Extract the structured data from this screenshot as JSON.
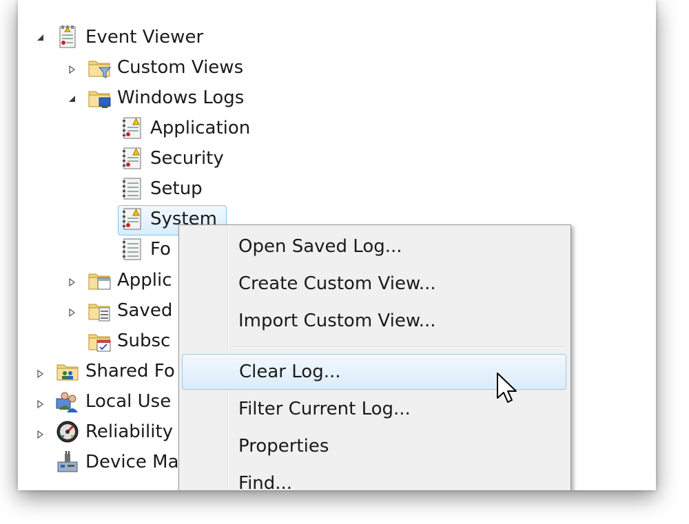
{
  "tree": {
    "items": [
      {
        "label": "Event Viewer",
        "icon": "event-viewer-icon",
        "expanded": true
      },
      {
        "label": "Custom Views",
        "icon": "folder-filter-icon",
        "expanded": false
      },
      {
        "label": "Windows Logs",
        "icon": "folder-computer-icon",
        "expanded": true
      },
      {
        "label": "Application",
        "icon": "log-warning-icon"
      },
      {
        "label": "Security",
        "icon": "log-warning-icon"
      },
      {
        "label": "Setup",
        "icon": "log-icon"
      },
      {
        "label": "System",
        "icon": "log-warning-icon",
        "selected": true
      },
      {
        "label": "Fo",
        "icon": "log-icon"
      },
      {
        "label": "Applic",
        "icon": "folder-window-icon",
        "expanded": false
      },
      {
        "label": "Saved",
        "icon": "folder-list-icon",
        "expanded": false
      },
      {
        "label": "Subsc",
        "icon": "folder-calendar-icon"
      },
      {
        "label": "Shared Fo",
        "icon": "shared-folders-icon",
        "expanded": false
      },
      {
        "label": "Local Use",
        "icon": "users-icon",
        "expanded": false
      },
      {
        "label": "Reliability",
        "icon": "reliability-icon",
        "expanded": false
      },
      {
        "label": "Device Ma",
        "icon": "device-manager-icon"
      }
    ]
  },
  "context_menu": {
    "items": [
      {
        "label": "Open Saved Log..."
      },
      {
        "label": "Create Custom View..."
      },
      {
        "label": "Import Custom View..."
      },
      {
        "label": "Clear Log...",
        "highlighted": true
      },
      {
        "label": "Filter Current Log..."
      },
      {
        "label": "Properties"
      },
      {
        "label": "Find..."
      }
    ]
  },
  "colors": {
    "selection_border": "#84c4ee",
    "menu_background": "#f0f0f0",
    "hover_border": "#9cc9ea"
  }
}
